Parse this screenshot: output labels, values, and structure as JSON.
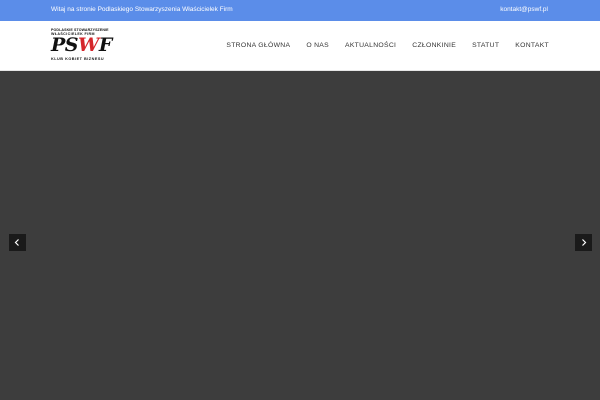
{
  "topbar": {
    "welcome": "Witaj na stronie Podlaskiego Stowarzyszenia Właścicielek Firm",
    "email": "kontakt@pswf.pl"
  },
  "logo": {
    "line1": "PODLASKIE STOWARZYSZENIE",
    "line2": "WŁAŚCICIELEK FIRM",
    "mark_ps": "PS",
    "mark_w": "W",
    "mark_f": "F",
    "line3": "KLUB KOBIET BIZNESU"
  },
  "nav": {
    "items": [
      {
        "label": "STRONA GŁÓWNA"
      },
      {
        "label": "O NAS"
      },
      {
        "label": "AKTUALNOŚCI"
      },
      {
        "label": "CZŁONKINIE"
      },
      {
        "label": "STATUT"
      },
      {
        "label": "KONTAKT"
      }
    ]
  },
  "slider": {
    "prev_icon": "chevron-left-icon",
    "next_icon": "chevron-right-icon"
  },
  "colors": {
    "topbar": "#5b8de9",
    "hero": "#3d3d3d",
    "logo_accent": "#d5262b"
  }
}
